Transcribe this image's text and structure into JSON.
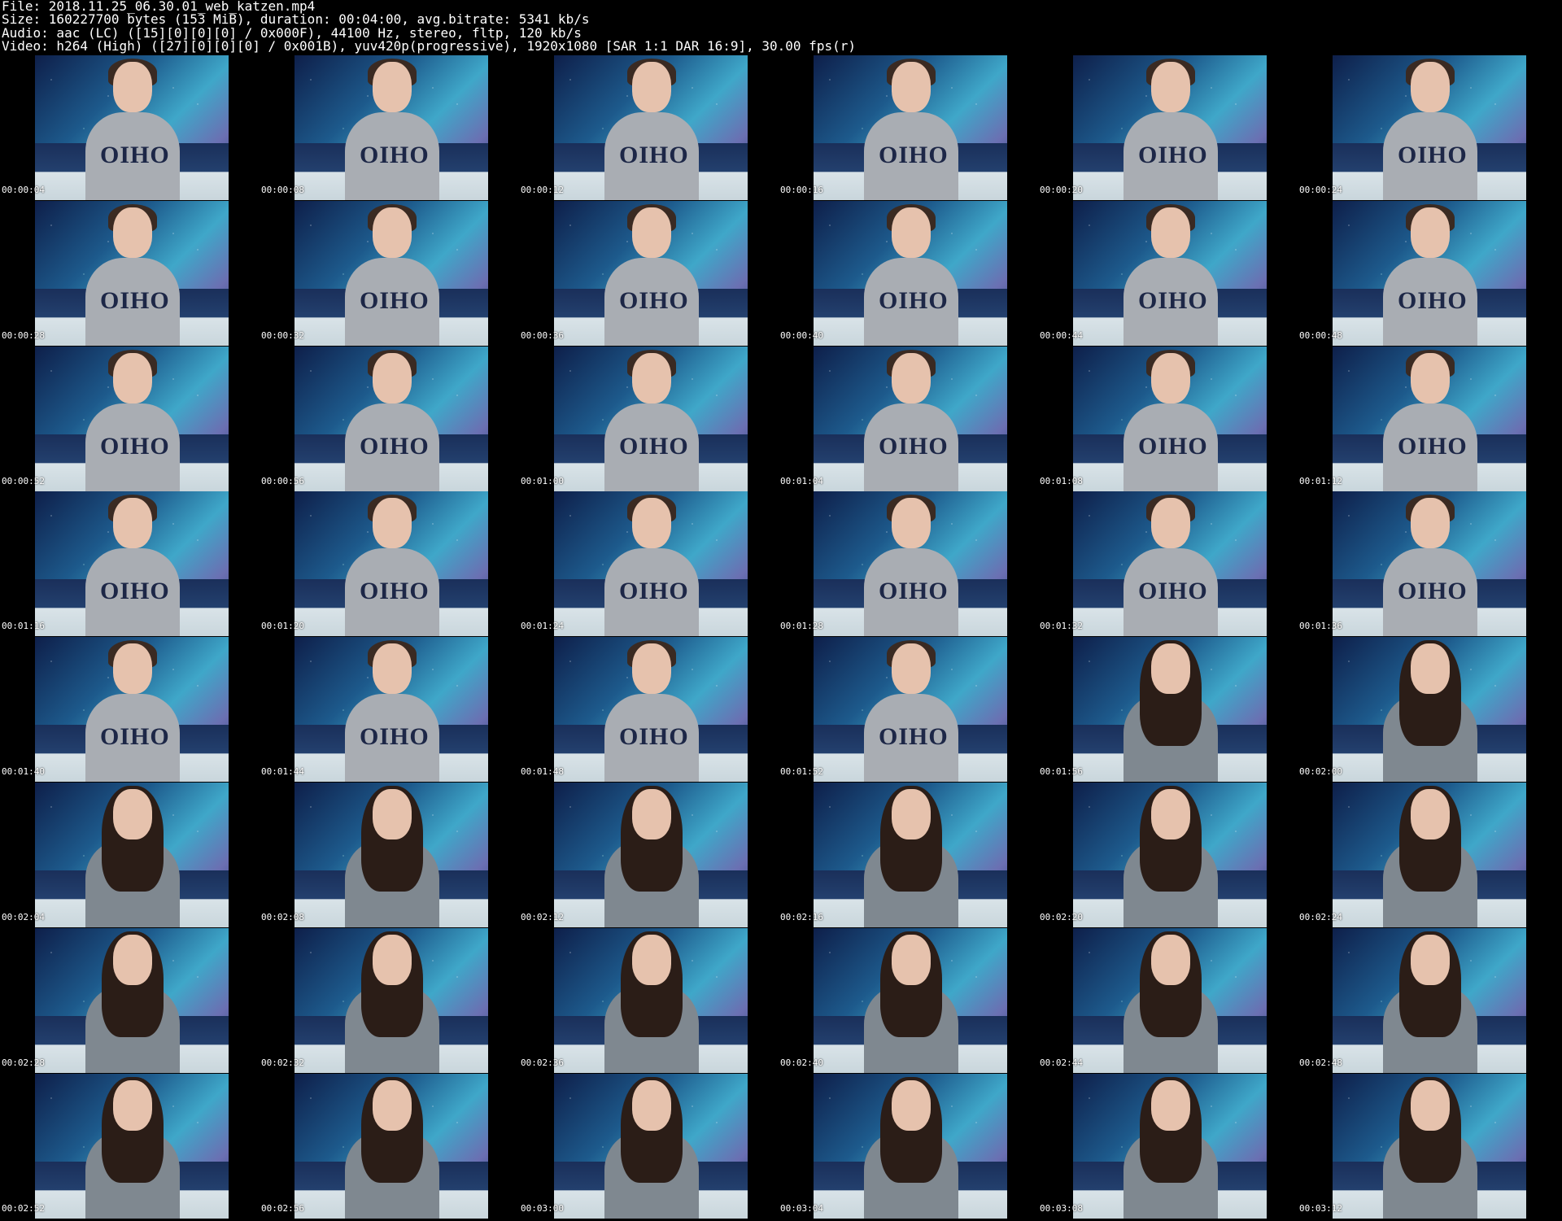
{
  "header": {
    "line1": "File: 2018.11.25_06.30.01_web_katzen.mp4",
    "line2": "Size: 160227700 bytes (153 MiB), duration: 00:04:00, avg.bitrate: 5341 kb/s",
    "line3": "Audio: aac (LC) ([15][0][0][0] / 0x000F), 44100 Hz, stereo, fltp, 120 kb/s",
    "line4": "Video: h264 (High) ([27][0][0][0] / 0x001B), yuv420p(progressive), 1920x1080 [SAR 1:1 DAR 16:9], 30.00 fps(r)"
  },
  "thumbnails": [
    {
      "time": "00:00:04",
      "subject": "boy"
    },
    {
      "time": "00:00:08",
      "subject": "boy"
    },
    {
      "time": "00:00:12",
      "subject": "boy"
    },
    {
      "time": "00:00:16",
      "subject": "boy"
    },
    {
      "time": "00:00:20",
      "subject": "boy"
    },
    {
      "time": "00:00:24",
      "subject": "boy"
    },
    {
      "time": "00:00:28",
      "subject": "boy"
    },
    {
      "time": "00:00:32",
      "subject": "boy"
    },
    {
      "time": "00:00:36",
      "subject": "boy"
    },
    {
      "time": "00:00:40",
      "subject": "boy"
    },
    {
      "time": "00:00:44",
      "subject": "boy"
    },
    {
      "time": "00:00:48",
      "subject": "boy"
    },
    {
      "time": "00:00:52",
      "subject": "boy"
    },
    {
      "time": "00:00:56",
      "subject": "boy"
    },
    {
      "time": "00:01:00",
      "subject": "boy"
    },
    {
      "time": "00:01:04",
      "subject": "boy"
    },
    {
      "time": "00:01:08",
      "subject": "boy"
    },
    {
      "time": "00:01:12",
      "subject": "boy"
    },
    {
      "time": "00:01:16",
      "subject": "boy"
    },
    {
      "time": "00:01:20",
      "subject": "boy"
    },
    {
      "time": "00:01:24",
      "subject": "boy"
    },
    {
      "time": "00:01:28",
      "subject": "boy"
    },
    {
      "time": "00:01:32",
      "subject": "boy"
    },
    {
      "time": "00:01:36",
      "subject": "boy"
    },
    {
      "time": "00:01:40",
      "subject": "boy"
    },
    {
      "time": "00:01:44",
      "subject": "boy"
    },
    {
      "time": "00:01:48",
      "subject": "boy"
    },
    {
      "time": "00:01:52",
      "subject": "boy"
    },
    {
      "time": "00:01:56",
      "subject": "girl"
    },
    {
      "time": "00:02:00",
      "subject": "girl"
    },
    {
      "time": "00:02:04",
      "subject": "girl"
    },
    {
      "time": "00:02:08",
      "subject": "girl"
    },
    {
      "time": "00:02:12",
      "subject": "girl"
    },
    {
      "time": "00:02:16",
      "subject": "girl"
    },
    {
      "time": "00:02:20",
      "subject": "girl"
    },
    {
      "time": "00:02:24",
      "subject": "girl"
    },
    {
      "time": "00:02:28",
      "subject": "girl"
    },
    {
      "time": "00:02:32",
      "subject": "girl"
    },
    {
      "time": "00:02:36",
      "subject": "girl"
    },
    {
      "time": "00:02:40",
      "subject": "girl"
    },
    {
      "time": "00:02:44",
      "subject": "girl"
    },
    {
      "time": "00:02:48",
      "subject": "girl"
    },
    {
      "time": "00:02:52",
      "subject": "girl"
    },
    {
      "time": "00:02:56",
      "subject": "girl"
    },
    {
      "time": "00:03:00",
      "subject": "girl"
    },
    {
      "time": "00:03:04",
      "subject": "girl"
    },
    {
      "time": "00:03:08",
      "subject": "girl"
    },
    {
      "time": "00:03:12",
      "subject": "girl"
    }
  ]
}
